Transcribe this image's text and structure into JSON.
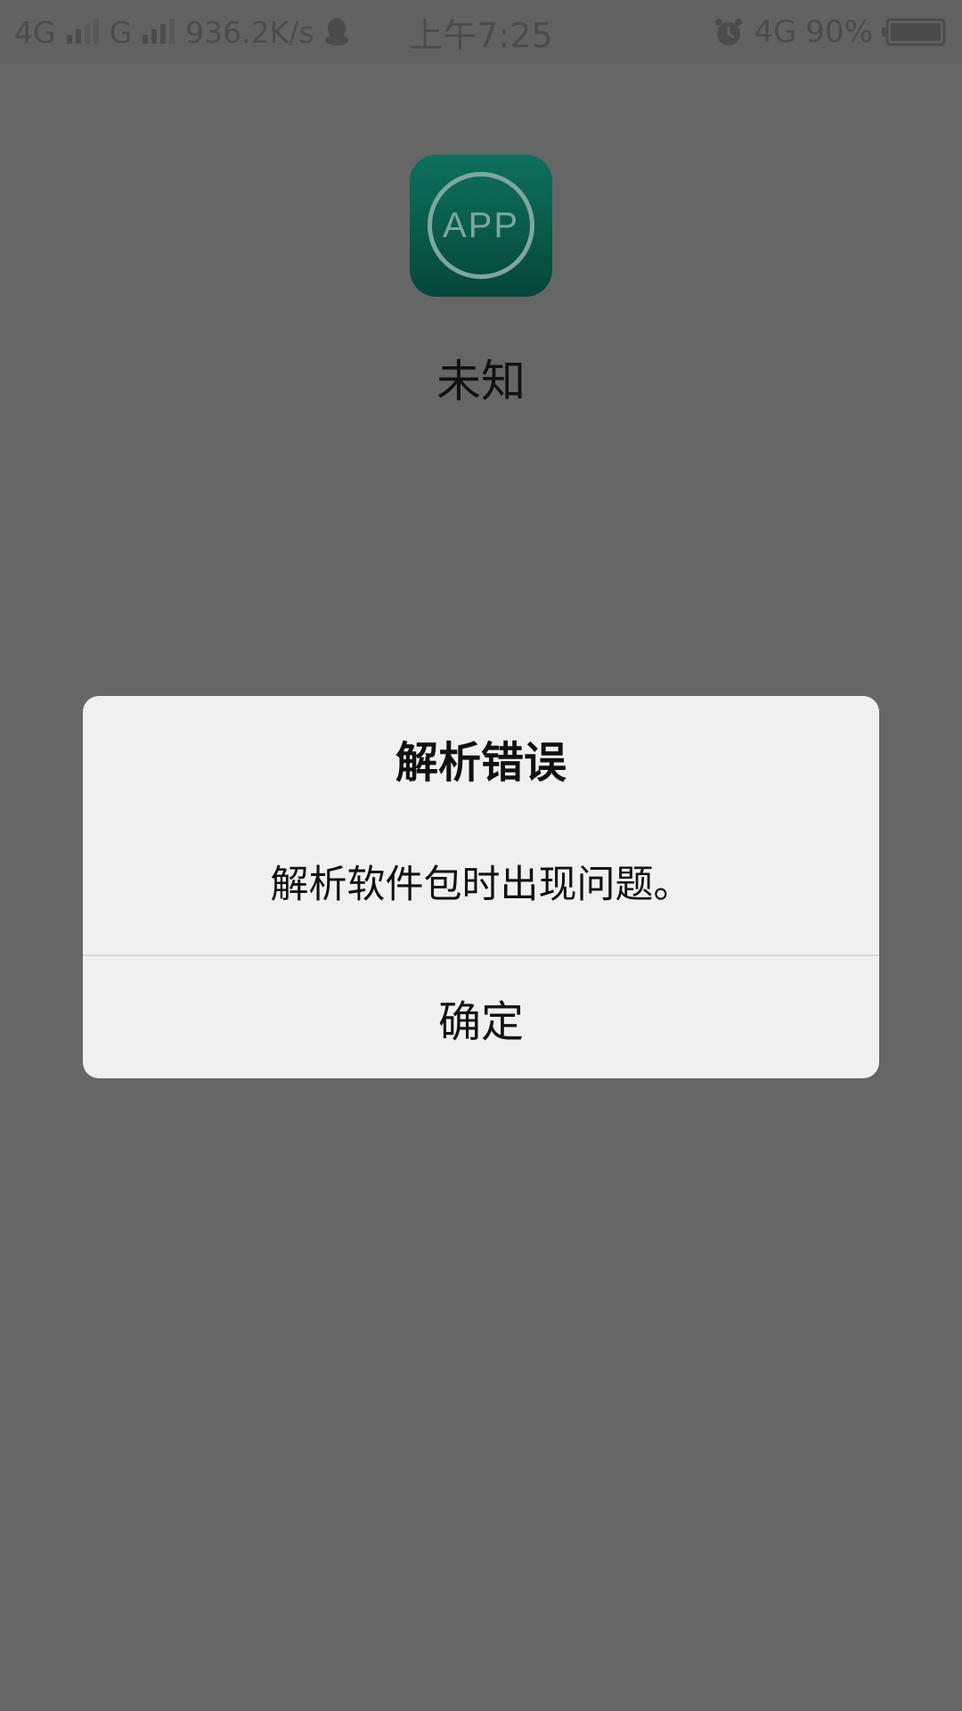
{
  "status_bar": {
    "network1": "4G",
    "network2": "G",
    "speed": "936.2K/s",
    "time": "上午7:25",
    "network_right": "4G",
    "battery_percent": "90%",
    "icons": [
      "signal-icon",
      "qq-icon",
      "alarm-icon",
      "battery-icon"
    ]
  },
  "app": {
    "icon_text": "APP",
    "name": "未知",
    "icon_color": "#0a5a4a"
  },
  "dialog": {
    "title": "解析错误",
    "message": "解析软件包时出现问题。",
    "ok_label": "确定"
  },
  "colors": {
    "overlay": "#666666",
    "dialog_bg": "#f0f0f0"
  }
}
